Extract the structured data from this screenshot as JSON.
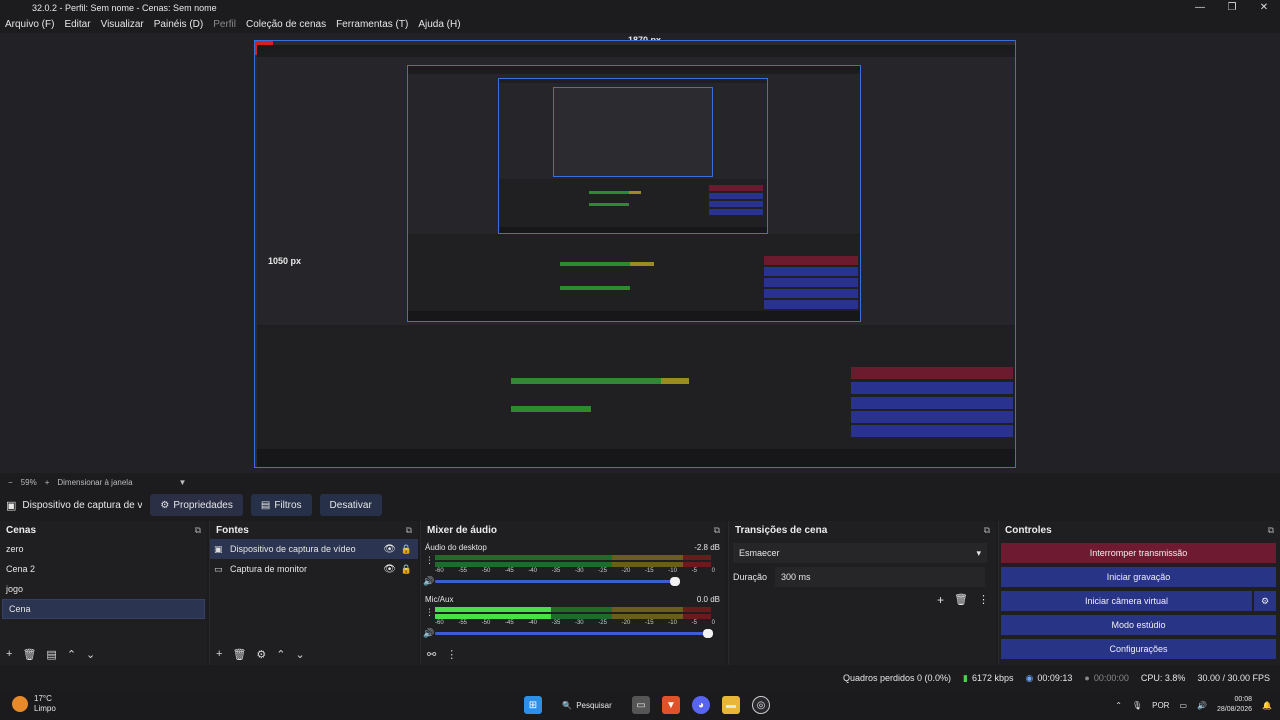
{
  "window": {
    "title": "32.0.2 - Perfil: Sem nome - Cenas: Sem nome",
    "minimize": "—",
    "maximize": "❐",
    "close": "✕"
  },
  "menu": [
    {
      "label": "Arquivo (F)"
    },
    {
      "label": "Editar"
    },
    {
      "label": "Visualizar"
    },
    {
      "label": "Painéis (D)"
    },
    {
      "label": "Perfil",
      "disabled": true
    },
    {
      "label": "Coleção de cenas"
    },
    {
      "label": "Ferramentas (T)"
    },
    {
      "label": "Ajuda (H)"
    }
  ],
  "preview": {
    "width_label": "1870 px",
    "height_label": "1050 px"
  },
  "zoom": {
    "minus": "−",
    "value": "59%",
    "plus": "+",
    "mode": "Dimensionar à janela",
    "arrow": "▼"
  },
  "source_toolbar": {
    "source_name": "Dispositivo de captura de v",
    "properties": "Propriedades",
    "filters": "Filtros",
    "deactivate": "Desativar"
  },
  "scenes": {
    "title": "Cenas",
    "items": [
      "zero",
      "Cena 2",
      "jogo",
      "Cena"
    ],
    "selected": 3
  },
  "sources": {
    "title": "Fontes",
    "items": [
      {
        "name": "Dispositivo de captura de vídeo",
        "icon": "camera-icon"
      },
      {
        "name": "Captura de monitor",
        "icon": "monitor-icon"
      }
    ]
  },
  "mixer": {
    "title": "Mixer de áudio",
    "scale": [
      "-60",
      "-55",
      "-50",
      "-45",
      "-40",
      "-35",
      "-30",
      "-25",
      "-20",
      "-15",
      "-10",
      "-5",
      "0"
    ],
    "channels": [
      {
        "name": "Áudio do desktop",
        "db": "-2.8 dB",
        "level": 0,
        "volume": 0.88
      },
      {
        "name": "Mic/Aux",
        "db": "0.0 dB",
        "level": 0.42,
        "volume": 1.0
      }
    ]
  },
  "transitions": {
    "title": "Transições de cena",
    "selected": "Esmaecer",
    "duration_label": "Duração",
    "duration_value": "300 ms"
  },
  "controls": {
    "title": "Controles",
    "stop_stream": "Interromper transmissão",
    "start_record": "Iniciar gravação",
    "start_virtualcam": "Iniciar câmera virtual",
    "studio_mode": "Modo estúdio",
    "settings": "Configurações"
  },
  "status": {
    "dropped": "Quadros perdidos 0 (0.0%)",
    "bitrate": "6172 kbps",
    "stream_time": "00:09:13",
    "record_time": "00:00:00",
    "cpu": "CPU: 3.8%",
    "fps": "30.00 / 30.00 FPS"
  },
  "taskbar": {
    "temp": "17°C",
    "weather": "Limpo",
    "search": "Pesquisar",
    "lang": "POR",
    "time": "00:08",
    "date": "28/08/2026"
  },
  "colors": {
    "accent": "#3b6fe0",
    "stop": "#6e1a30",
    "control": "#283486"
  }
}
